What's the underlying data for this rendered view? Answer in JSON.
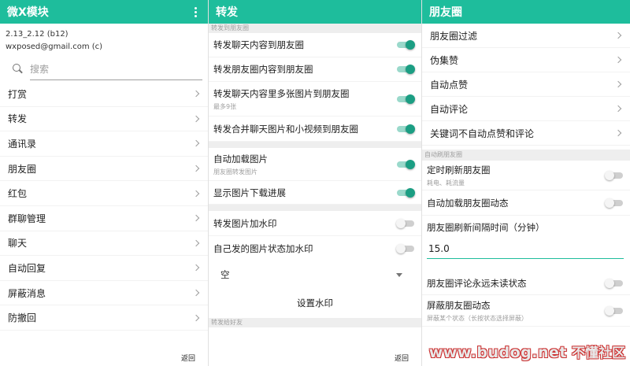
{
  "colors": {
    "accent": "#1ebd9c",
    "toggle_on": "#1b9e83",
    "watermark": "#cc3333"
  },
  "panel1": {
    "title": "微X模块",
    "more_icon": "more-vert-icon",
    "version": "2.13_2.12 (b12)",
    "email": "wxposed@gmail.com (c)",
    "search_placeholder": "搜索",
    "nav_items": [
      {
        "label": "打赏"
      },
      {
        "label": "转发"
      },
      {
        "label": "通讯录"
      },
      {
        "label": "朋友圈"
      },
      {
        "label": "红包"
      },
      {
        "label": "群聊管理"
      },
      {
        "label": "聊天"
      },
      {
        "label": "自动回复"
      },
      {
        "label": "屏蔽消息"
      },
      {
        "label": "防撤回"
      }
    ],
    "back_label": "返回"
  },
  "panel2": {
    "title": "转发",
    "section1": "转发到朋友圈",
    "items1": [
      {
        "label": "转发聊天内容到朋友圈",
        "on": true
      },
      {
        "label": "转发朋友圈内容到朋友圈",
        "on": true
      },
      {
        "label": "转发聊天内容里多张图片到朋友圈",
        "sub": "最多9张",
        "on": true
      },
      {
        "label": "转发合并聊天图片和小视频到朋友圈",
        "on": true
      }
    ],
    "items2": [
      {
        "label": "自动加载图片",
        "sub": "朋友圈转发图片",
        "on": true
      },
      {
        "label": "显示图片下载进展",
        "on": true
      }
    ],
    "items3": [
      {
        "label": "转发图片加水印",
        "on": false
      },
      {
        "label": "自己发的图片状态加水印",
        "on": false
      }
    ],
    "select_value": "空",
    "watermark_button": "设置水印",
    "section2": "转发给好友",
    "back_label": "返回"
  },
  "panel3": {
    "title": "朋友圈",
    "nav_items": [
      {
        "label": "朋友圈过滤"
      },
      {
        "label": "伪集赞"
      },
      {
        "label": "自动点赞"
      },
      {
        "label": "自动评论"
      },
      {
        "label": "关键词不自动点赞和评论"
      }
    ],
    "section1": "自动刷朋友圈",
    "refresh_items": [
      {
        "label": "定时刷新朋友圈",
        "sub": "耗电、耗流量",
        "on": false
      },
      {
        "label": "自动加载朋友圈动态",
        "on": false
      }
    ],
    "interval_label": "朋友圈刷新间隔时间（分钟）",
    "interval_value": "15.0",
    "items2": [
      {
        "label": "朋友圈评论永远未读状态",
        "on": false
      },
      {
        "label": "屏蔽朋友圈动态",
        "sub": "屏蔽某个状态（长按状态选择屏蔽）",
        "on": false
      }
    ],
    "watermark_url": "www.budog.net",
    "watermark_cn": "不懂社区"
  }
}
